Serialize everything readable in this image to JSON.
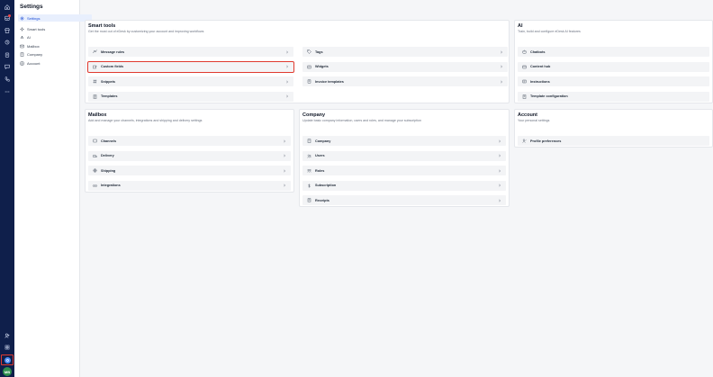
{
  "sidebar": {
    "title": "Settings",
    "items": [
      {
        "label": "Settings",
        "icon": "settings-icon"
      },
      {
        "label": "Smart tools",
        "icon": "sparkle-icon"
      },
      {
        "label": "AI",
        "icon": "ai-icon"
      },
      {
        "label": "Mailbox",
        "icon": "mailbox-icon"
      },
      {
        "label": "Company",
        "icon": "building-icon"
      },
      {
        "label": "Account",
        "icon": "account-icon"
      }
    ]
  },
  "rail": {
    "avatar_initials": "MB"
  },
  "cards": {
    "smart_tools": {
      "title": "Smart tools",
      "desc": "Get the most out of eDesk by customizing your account and improving workflows",
      "rows": [
        "Message rules",
        "Tags",
        "Custom fields",
        "Widgets",
        "Snippets",
        "Invoice templates",
        "Templates"
      ]
    },
    "ai": {
      "title": "AI",
      "desc": "Train, build and configure eDesk AI features",
      "rows": [
        "Chatbots",
        "Content hub",
        "Instructions",
        "Template configuration"
      ]
    },
    "mailbox": {
      "title": "Mailbox",
      "desc": "Add and manage your channels, integrations and shipping and delivery settings",
      "rows": [
        "Channels",
        "Delivery",
        "Shipping",
        "Integrations"
      ]
    },
    "company": {
      "title": "Company",
      "desc": "Update basic company information, users and roles, and manage your subscription",
      "rows": [
        "Company",
        "Users",
        "Roles",
        "Subscription",
        "Receipts"
      ]
    },
    "account": {
      "title": "Account",
      "desc": "Your personal settings",
      "rows": [
        "Profile preferences"
      ]
    }
  },
  "colors": {
    "rail_bg": "#0f1f4b",
    "highlight": "#e03a2f",
    "active_bg": "#e8effd",
    "accent": "#1d4ed8"
  }
}
